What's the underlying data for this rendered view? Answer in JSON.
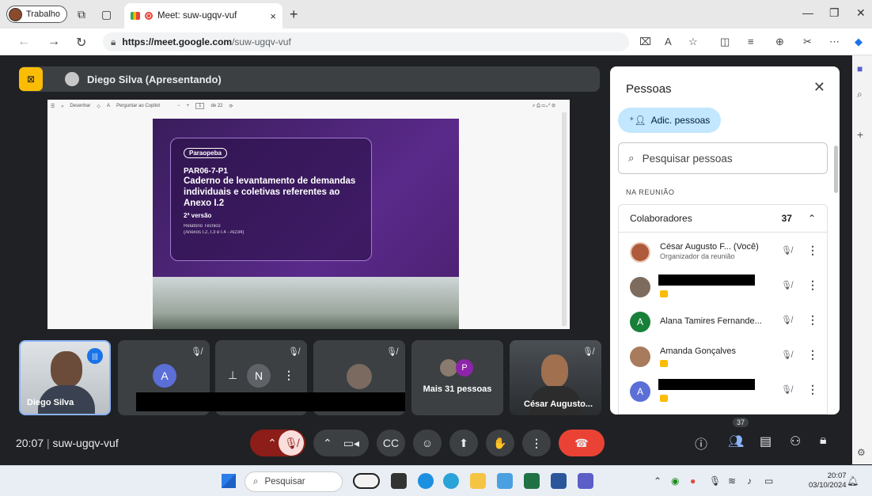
{
  "browser": {
    "profile_label": "Trabalho",
    "tab_title": "Meet: suw-ugqv-vuf",
    "tab_close": "×",
    "new_tab": "+",
    "url_host": "https://meet.google.com",
    "url_path": "/suw-ugqv-vuf"
  },
  "meet": {
    "presenter_name": "Diego Silva (Apresentando)",
    "slide": {
      "chip": "Paraopeba",
      "code": "PAR06-7-P1",
      "title": "Caderno de levantamento de demandas individuais e coletivas referentes ao Anexo I.2",
      "version": "2ª versão",
      "subtitle_1": "Relatório Técnico",
      "subtitle_2": "(Anexos I.2, I.3 e I.4 - AI234)"
    },
    "pdf_toolbar": {
      "draw": "Desenhar",
      "copilot": "Perguntar ao Copilot",
      "page": "1",
      "of": "de 22"
    },
    "tiles": [
      {
        "name": "Diego Silva"
      },
      {
        "letter": "A"
      },
      {
        "letter": "N"
      },
      {
        "name": ""
      },
      {
        "name": "Mais 31 pessoas",
        "letter": "P"
      },
      {
        "name": "César Augusto..."
      }
    ],
    "time": "20:07",
    "separator": "|",
    "meeting_code": "suw-ugqv-vuf",
    "people_count_badge": "37"
  },
  "people_panel": {
    "title": "Pessoas",
    "close": "✕",
    "add_label": "Adic. pessoas",
    "search_placeholder": "Pesquisar pessoas",
    "section": "NA REUNIÃO",
    "group_label": "Colaboradores",
    "group_count": "37",
    "participants": [
      {
        "name": "César Augusto F... (Você)",
        "role": "Organizador da reunião",
        "letter": ""
      },
      {
        "name": "",
        "role": "",
        "letter": ""
      },
      {
        "name": "Alana Tamires Fernande...",
        "role": "",
        "letter": "A"
      },
      {
        "name": "Amanda Gonçalves",
        "role": "",
        "letter": ""
      },
      {
        "name": "",
        "role": "",
        "letter": "A"
      }
    ]
  },
  "taskbar": {
    "search_label": "Pesquisar",
    "time": "20:07",
    "date": "03/10/2024"
  },
  "colors": {
    "meet_bg": "#202124",
    "tile_bg": "#3c4043",
    "end_call": "#ea4335",
    "presenter_yellow": "#fbbc04",
    "add_people_bg": "#c2e7ff"
  }
}
